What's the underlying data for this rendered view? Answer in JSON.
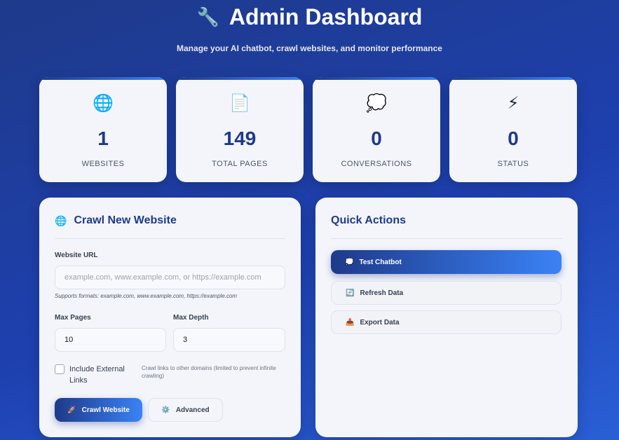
{
  "header": {
    "icon": "wrench-icon",
    "icon_glyph": "🔧",
    "title": "Admin Dashboard",
    "subtitle": "Manage your AI chatbot, crawl websites, and monitor performance"
  },
  "stats": [
    {
      "icon": "globe-icon",
      "glyph": "🌐",
      "value": "1",
      "label": "WEBSITES"
    },
    {
      "icon": "document-icon",
      "glyph": "📄",
      "value": "149",
      "label": "TOTAL PAGES"
    },
    {
      "icon": "speech-bubble-icon",
      "glyph": "💭",
      "value": "0",
      "label": "CONVERSATIONS"
    },
    {
      "icon": "lightning-icon",
      "glyph": "⚡",
      "value": "0",
      "label": "STATUS"
    }
  ],
  "crawl": {
    "icon": "globe-icon",
    "icon_glyph": "🌐",
    "title": "Crawl New Website",
    "url_label": "Website URL",
    "url_placeholder": "example.com, www.example.com, or https://example.com",
    "url_value": "",
    "url_hint": "Supports formats: example.com, www.example.com, https://example.com",
    "max_pages_label": "Max Pages",
    "max_pages_value": "10",
    "max_depth_label": "Max Depth",
    "max_depth_value": "3",
    "include_external_label": "Include External Links",
    "include_external_checked": false,
    "include_external_hint": "Crawl links to other domains (limited to prevent infinite crawling)",
    "crawl_button": {
      "icon": "rocket-icon",
      "glyph": "🚀",
      "label": "Crawl Website"
    },
    "advanced_button": {
      "icon": "gear-icon",
      "glyph": "⚙️",
      "label": "Advanced"
    }
  },
  "quick_actions": {
    "title": "Quick Actions",
    "buttons": [
      {
        "icon": "speech-bubble-icon",
        "glyph": "💭",
        "label": "Test Chatbot"
      },
      {
        "icon": "refresh-icon",
        "glyph": "🔄",
        "label": "Refresh Data"
      },
      {
        "icon": "export-icon",
        "glyph": "📥",
        "label": "Export Data"
      }
    ]
  },
  "colors": {
    "accent": "#1e3a8a",
    "accent_light": "#3b82f6",
    "background": "#1e40af",
    "card": "#f3f5fb"
  }
}
